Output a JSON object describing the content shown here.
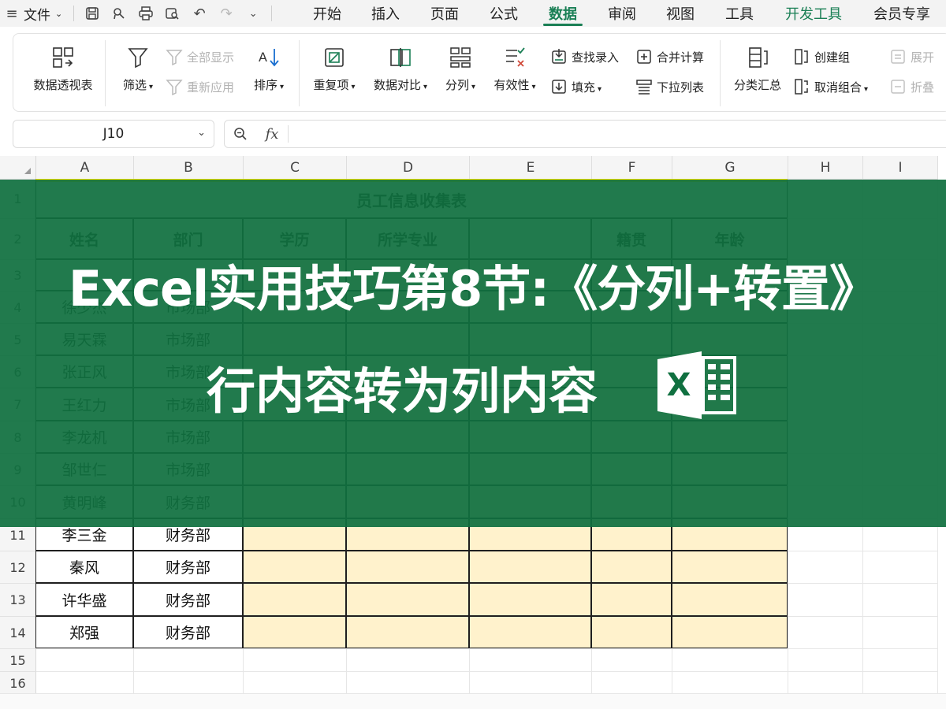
{
  "menubar": {
    "file_label": "文件",
    "tabs": [
      {
        "label": "开始"
      },
      {
        "label": "插入"
      },
      {
        "label": "页面"
      },
      {
        "label": "公式"
      },
      {
        "label": "数据",
        "active": true
      },
      {
        "label": "审阅"
      },
      {
        "label": "视图"
      },
      {
        "label": "工具"
      },
      {
        "label": "开发工具"
      },
      {
        "label": "会员专享"
      }
    ]
  },
  "ribbon": {
    "pivot": "数据透视表",
    "filter": "筛选",
    "show_all": "全部显示",
    "reapply": "重新应用",
    "sort": "排序",
    "duplicates": "重复项",
    "compare": "数据对比",
    "split": "分列",
    "validity": "有效性",
    "lookup": "查找录入",
    "fill": "填充",
    "consolidate": "合并计算",
    "dropdown_list": "下拉列表",
    "subtotal": "分类汇总",
    "create_group": "创建组",
    "ungroup": "取消组合",
    "expand": "展开",
    "collapse": "折叠"
  },
  "formula_bar": {
    "cell_ref": "J10",
    "fx": "fx",
    "value": ""
  },
  "sheet": {
    "columns": [
      "A",
      "B",
      "C",
      "D",
      "E",
      "F",
      "G",
      "H",
      "I"
    ],
    "rows": [
      "1",
      "2",
      "3",
      "4",
      "5",
      "6",
      "7",
      "8",
      "9",
      "10",
      "11",
      "12",
      "13",
      "14",
      "15",
      "16"
    ],
    "title": "员工信息收集表",
    "headers": [
      "姓名",
      "部门",
      "学历",
      "所学专业",
      "",
      "籍贯",
      "年龄"
    ],
    "data": [
      {
        "name": "",
        "dept": ""
      },
      {
        "name": "徐少杰",
        "dept": "市场部"
      },
      {
        "name": "易天霖",
        "dept": "市场部"
      },
      {
        "name": "张正风",
        "dept": "市场部"
      },
      {
        "name": "王红力",
        "dept": "市场部"
      },
      {
        "name": "李龙机",
        "dept": "市场部"
      },
      {
        "name": "邹世仁",
        "dept": "市场部"
      },
      {
        "name": "黄明峰",
        "dept": "财务部"
      },
      {
        "name": "李三金",
        "dept": "财务部"
      },
      {
        "name": "秦风",
        "dept": "财务部"
      },
      {
        "name": "许华盛",
        "dept": "财务部"
      },
      {
        "name": "郑强",
        "dept": "财务部"
      }
    ],
    "accent_color": "#1a7f55",
    "fill_color": "#fff2cc"
  },
  "banner": {
    "line1": "Excel实用技巧第8节:《分列+转置》",
    "line2": "行内容转为列内容",
    "color": "#107040",
    "logo_icon": "excel-logo-icon"
  }
}
